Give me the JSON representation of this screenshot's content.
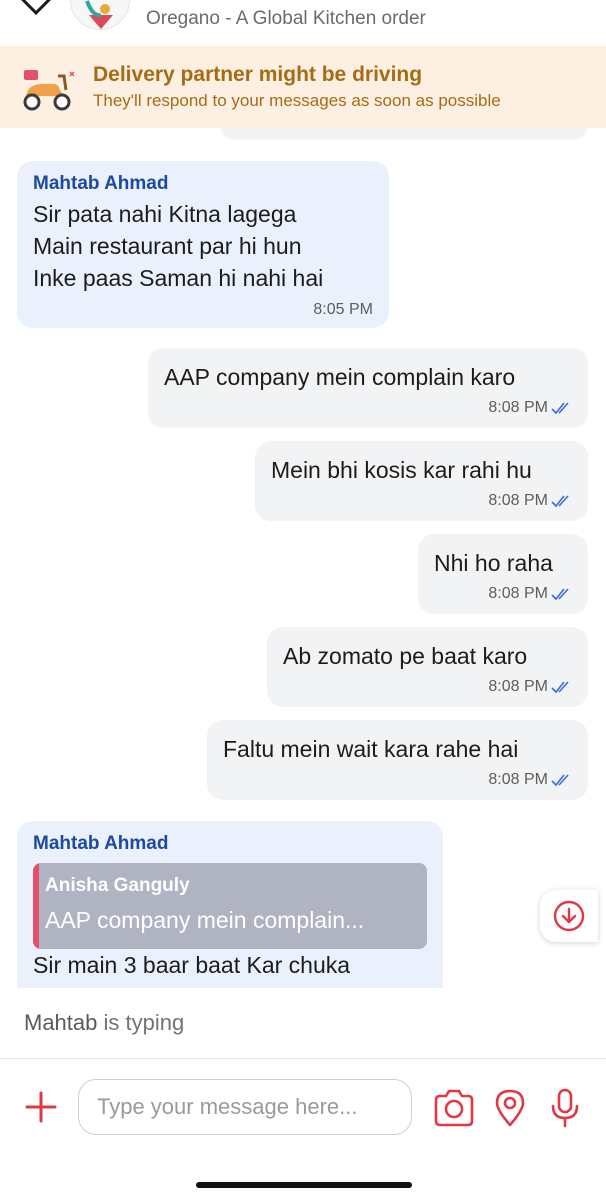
{
  "header": {
    "subtitle": "Oregano - A Global Kitchen order",
    "back_icon": "chevron-down-icon",
    "avatar_icon": "restaurant-avatar"
  },
  "banner": {
    "title": "Delivery partner might be driving",
    "subtitle": "They'll respond to your messages as soon as possible",
    "icon": "scooter-icon",
    "color": "#a66b15",
    "background": "#fdf0e2"
  },
  "messages": [
    {
      "direction": "incoming",
      "sender": "Mahtab Ahmad",
      "lines": [
        "Sir pata nahi Kitna lagega",
        "Main restaurant par hi hun",
        "Inke paas Saman hi nahi hai"
      ],
      "time": "8:05 PM"
    },
    {
      "direction": "outgoing",
      "text": "AAP company mein complain karo",
      "time": "8:08 PM",
      "status": "read"
    },
    {
      "direction": "outgoing",
      "text": "Mein bhi kosis kar rahi hu",
      "time": "8:08 PM",
      "status": "read"
    },
    {
      "direction": "outgoing",
      "text": "Nhi ho raha",
      "time": "8:08 PM",
      "status": "read"
    },
    {
      "direction": "outgoing",
      "text": "Ab zomato pe baat karo",
      "time": "8:08 PM",
      "status": "read"
    },
    {
      "direction": "outgoing",
      "text": "Faltu mein wait kara rahe hai",
      "time": "8:08 PM",
      "status": "read"
    },
    {
      "direction": "incoming",
      "sender": "Mahtab Ahmad",
      "reply_to": {
        "name": "Anisha Ganguly",
        "text": "AAP company mein complain..."
      },
      "text": "Sir main 3 baar baat Kar chuka"
    }
  ],
  "typing": {
    "name": "Mahtab",
    "suffix": " is typing"
  },
  "composer": {
    "placeholder": "Type your message here...",
    "icons": [
      "plus-icon",
      "camera-icon",
      "location-pin-icon",
      "microphone-icon"
    ]
  },
  "colors": {
    "accent": "#e23744",
    "sender_name": "#1b4aa0",
    "incoming_bubble": "#eaf1fc",
    "outgoing_bubble": "#f2f3f5",
    "read_tick": "#3a6fd8"
  }
}
